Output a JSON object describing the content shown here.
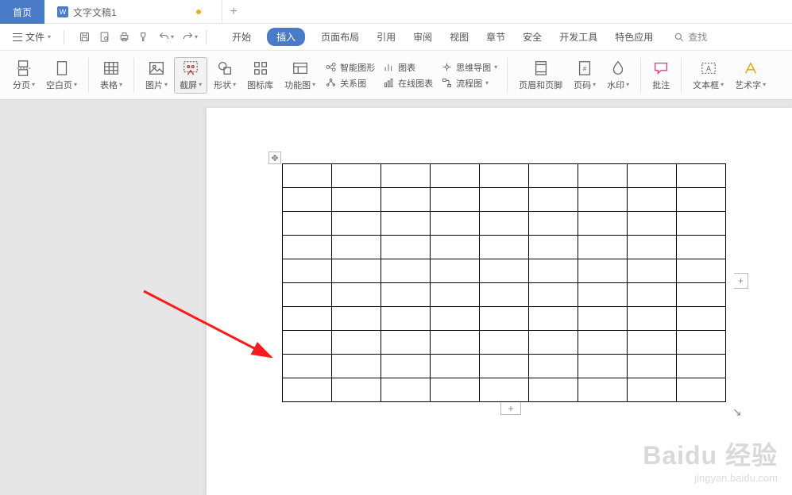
{
  "tabs": {
    "home": "首页",
    "doc_icon": "W",
    "doc": "文字文稿1",
    "add": "+"
  },
  "file_menu": "文件",
  "menus": {
    "start": "开始",
    "insert": "插入",
    "pagelayout": "页面布局",
    "reference": "引用",
    "review": "审阅",
    "view": "视图",
    "chapter": "章节",
    "safety": "安全",
    "devtools": "开发工具",
    "special": "特色应用"
  },
  "search": "查找",
  "ribbon": {
    "pagebreak": "分页",
    "blankpage": "空白页",
    "table": "表格",
    "picture": "图片",
    "screenshot": "截屏",
    "shape": "形状",
    "iconlib": "图标库",
    "funcimg": "功能图",
    "smartart": "智能图形",
    "chart": "图表",
    "mindmap": "思维导图",
    "relation": "关系图",
    "onlinechart": "在线图表",
    "flowchart": "流程图",
    "headerfooter": "页眉和页脚",
    "pagenum": "页码",
    "watermark": "水印",
    "comment": "批注",
    "textbox": "文本框",
    "wordart": "艺术字"
  },
  "handles": {
    "addrow": "+",
    "addcol": "+",
    "move": "✥",
    "resize": "↘"
  },
  "watermark": {
    "brand": "Baidu 经验",
    "url": "jingyan.baidu.com"
  },
  "table_grid": {
    "rows": 10,
    "cols": 9
  }
}
